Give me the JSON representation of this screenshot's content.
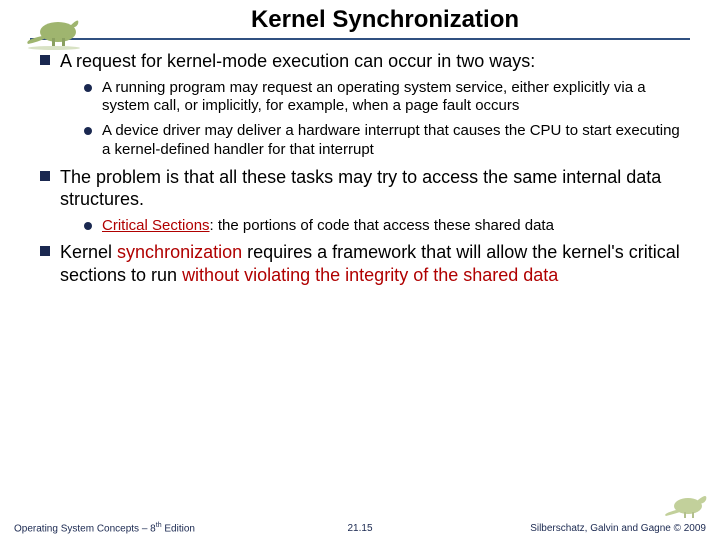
{
  "title": "Kernel Synchronization",
  "b1": {
    "main": "A request for kernel-mode execution can occur in two ways:",
    "s1": "A running program may request an operating system service, either explicitly via a system call, or implicitly, for example, when a page fault occurs",
    "s2": "A device driver may deliver a hardware interrupt that causes the CPU to start executing a kernel-defined handler for that interrupt"
  },
  "b2": {
    "main": "The problem is that all these tasks may try to access the same internal data structures.",
    "s1_label_red": "Critical Sections",
    "s1_rest": ": the portions of code that access these shared data"
  },
  "b3": {
    "p1": "Kernel ",
    "p2": "synchronization",
    "p3": " requires a framework that will allow the kernel's critical sections to run ",
    "p4": "without violating the integrity of the shared data"
  },
  "footer": {
    "left": "Operating System Concepts – 8",
    "left_sup": "th",
    "left2": " Edition",
    "center": "21.15",
    "right": "Silberschatz, Galvin and Gagne © 2009"
  }
}
